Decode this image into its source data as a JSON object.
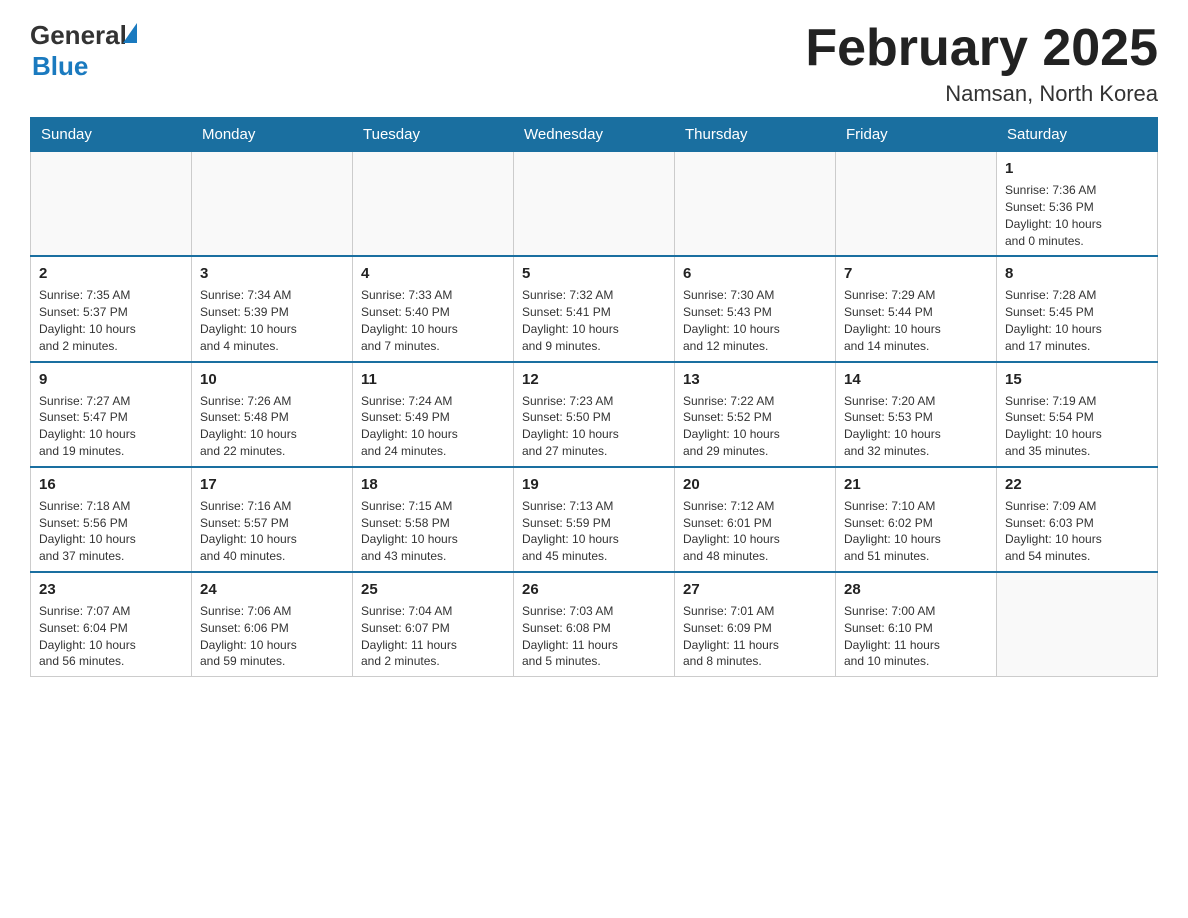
{
  "header": {
    "logo_general": "General",
    "logo_blue": "Blue",
    "month_title": "February 2025",
    "location": "Namsan, North Korea"
  },
  "weekdays": [
    "Sunday",
    "Monday",
    "Tuesday",
    "Wednesday",
    "Thursday",
    "Friday",
    "Saturday"
  ],
  "weeks": [
    [
      {
        "day": "",
        "info": ""
      },
      {
        "day": "",
        "info": ""
      },
      {
        "day": "",
        "info": ""
      },
      {
        "day": "",
        "info": ""
      },
      {
        "day": "",
        "info": ""
      },
      {
        "day": "",
        "info": ""
      },
      {
        "day": "1",
        "info": "Sunrise: 7:36 AM\nSunset: 5:36 PM\nDaylight: 10 hours\nand 0 minutes."
      }
    ],
    [
      {
        "day": "2",
        "info": "Sunrise: 7:35 AM\nSunset: 5:37 PM\nDaylight: 10 hours\nand 2 minutes."
      },
      {
        "day": "3",
        "info": "Sunrise: 7:34 AM\nSunset: 5:39 PM\nDaylight: 10 hours\nand 4 minutes."
      },
      {
        "day": "4",
        "info": "Sunrise: 7:33 AM\nSunset: 5:40 PM\nDaylight: 10 hours\nand 7 minutes."
      },
      {
        "day": "5",
        "info": "Sunrise: 7:32 AM\nSunset: 5:41 PM\nDaylight: 10 hours\nand 9 minutes."
      },
      {
        "day": "6",
        "info": "Sunrise: 7:30 AM\nSunset: 5:43 PM\nDaylight: 10 hours\nand 12 minutes."
      },
      {
        "day": "7",
        "info": "Sunrise: 7:29 AM\nSunset: 5:44 PM\nDaylight: 10 hours\nand 14 minutes."
      },
      {
        "day": "8",
        "info": "Sunrise: 7:28 AM\nSunset: 5:45 PM\nDaylight: 10 hours\nand 17 minutes."
      }
    ],
    [
      {
        "day": "9",
        "info": "Sunrise: 7:27 AM\nSunset: 5:47 PM\nDaylight: 10 hours\nand 19 minutes."
      },
      {
        "day": "10",
        "info": "Sunrise: 7:26 AM\nSunset: 5:48 PM\nDaylight: 10 hours\nand 22 minutes."
      },
      {
        "day": "11",
        "info": "Sunrise: 7:24 AM\nSunset: 5:49 PM\nDaylight: 10 hours\nand 24 minutes."
      },
      {
        "day": "12",
        "info": "Sunrise: 7:23 AM\nSunset: 5:50 PM\nDaylight: 10 hours\nand 27 minutes."
      },
      {
        "day": "13",
        "info": "Sunrise: 7:22 AM\nSunset: 5:52 PM\nDaylight: 10 hours\nand 29 minutes."
      },
      {
        "day": "14",
        "info": "Sunrise: 7:20 AM\nSunset: 5:53 PM\nDaylight: 10 hours\nand 32 minutes."
      },
      {
        "day": "15",
        "info": "Sunrise: 7:19 AM\nSunset: 5:54 PM\nDaylight: 10 hours\nand 35 minutes."
      }
    ],
    [
      {
        "day": "16",
        "info": "Sunrise: 7:18 AM\nSunset: 5:56 PM\nDaylight: 10 hours\nand 37 minutes."
      },
      {
        "day": "17",
        "info": "Sunrise: 7:16 AM\nSunset: 5:57 PM\nDaylight: 10 hours\nand 40 minutes."
      },
      {
        "day": "18",
        "info": "Sunrise: 7:15 AM\nSunset: 5:58 PM\nDaylight: 10 hours\nand 43 minutes."
      },
      {
        "day": "19",
        "info": "Sunrise: 7:13 AM\nSunset: 5:59 PM\nDaylight: 10 hours\nand 45 minutes."
      },
      {
        "day": "20",
        "info": "Sunrise: 7:12 AM\nSunset: 6:01 PM\nDaylight: 10 hours\nand 48 minutes."
      },
      {
        "day": "21",
        "info": "Sunrise: 7:10 AM\nSunset: 6:02 PM\nDaylight: 10 hours\nand 51 minutes."
      },
      {
        "day": "22",
        "info": "Sunrise: 7:09 AM\nSunset: 6:03 PM\nDaylight: 10 hours\nand 54 minutes."
      }
    ],
    [
      {
        "day": "23",
        "info": "Sunrise: 7:07 AM\nSunset: 6:04 PM\nDaylight: 10 hours\nand 56 minutes."
      },
      {
        "day": "24",
        "info": "Sunrise: 7:06 AM\nSunset: 6:06 PM\nDaylight: 10 hours\nand 59 minutes."
      },
      {
        "day": "25",
        "info": "Sunrise: 7:04 AM\nSunset: 6:07 PM\nDaylight: 11 hours\nand 2 minutes."
      },
      {
        "day": "26",
        "info": "Sunrise: 7:03 AM\nSunset: 6:08 PM\nDaylight: 11 hours\nand 5 minutes."
      },
      {
        "day": "27",
        "info": "Sunrise: 7:01 AM\nSunset: 6:09 PM\nDaylight: 11 hours\nand 8 minutes."
      },
      {
        "day": "28",
        "info": "Sunrise: 7:00 AM\nSunset: 6:10 PM\nDaylight: 11 hours\nand 10 minutes."
      },
      {
        "day": "",
        "info": ""
      }
    ]
  ]
}
